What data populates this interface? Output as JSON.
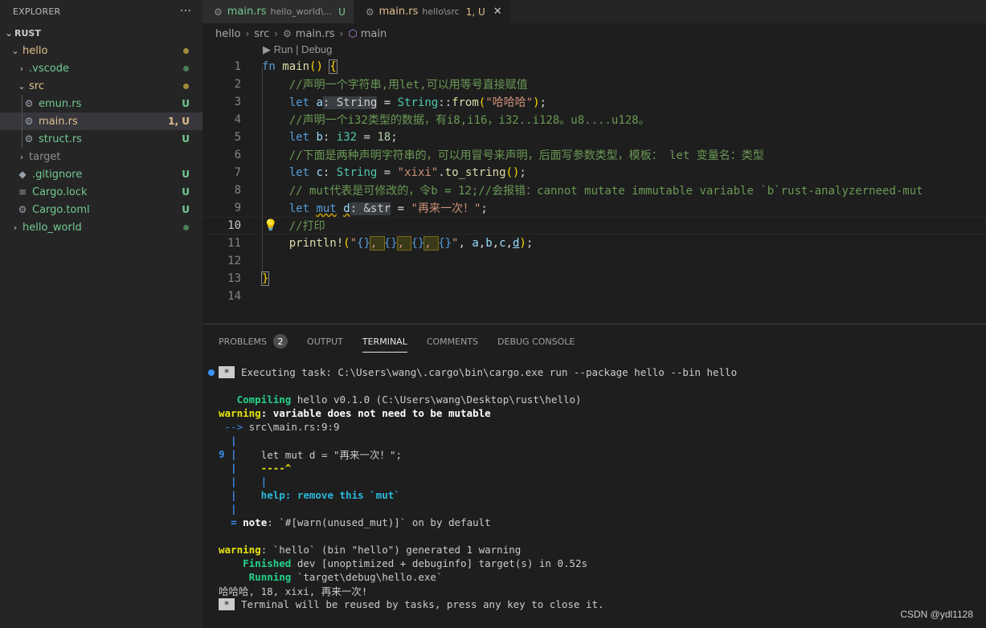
{
  "sidebar": {
    "title": "EXPLORER",
    "more": "···",
    "root": "RUST",
    "items": [
      {
        "label": "hello",
        "status": "",
        "color": "#e2c08d"
      },
      {
        "label": ".vscode",
        "status": "",
        "color": "#73c991"
      },
      {
        "label": "src",
        "status": "",
        "color": "#e2c08d"
      },
      {
        "label": "emun.rs",
        "status": "U",
        "color": "#73c991"
      },
      {
        "label": "main.rs",
        "status": "1, U",
        "color": "#e2c08d"
      },
      {
        "label": "struct.rs",
        "status": "U",
        "color": "#73c991"
      },
      {
        "label": "target",
        "status": "",
        "color": "#8c8c8c"
      },
      {
        "label": ".gitignore",
        "status": "U",
        "color": "#73c991"
      },
      {
        "label": "Cargo.lock",
        "status": "U",
        "color": "#73c991"
      },
      {
        "label": "Cargo.toml",
        "status": "U",
        "color": "#73c991"
      },
      {
        "label": "hello_world",
        "status": "",
        "color": "#73c991"
      }
    ]
  },
  "tabs": [
    {
      "name": "main.rs",
      "desc": "hello_world\\...",
      "status": "U"
    },
    {
      "name": "main.rs",
      "desc": "hello\\src",
      "status": "1, U",
      "close": "✕"
    }
  ],
  "breadcrumb": [
    "hello",
    "src",
    "main.rs",
    "main"
  ],
  "editor": {
    "codelens": "▶ Run | Debug",
    "line_numbers": [
      "1",
      "2",
      "3",
      "4",
      "5",
      "6",
      "7",
      "8",
      "9",
      "10",
      "11",
      "12",
      "13",
      "14"
    ],
    "comments": {
      "l2": "//声明一个字符串,用let,可以用等号直接赋值",
      "l4": "//声明一个i32类型的数据，有i8,i16，i32..i128。u8....u128。",
      "l6": "//下面是两种声明字符串的，可以用冒号来声明，后面写参数类型，模板： let 变量名：类型",
      "l8": "// mut代表是可修改的，令b = 12;//会报错：cannot mutate immutable variable `b`rust-analyzerneed-mut",
      "l10": "//打印"
    },
    "strings": {
      "a": "\"哈哈哈\"",
      "c": "\"xixi\"",
      "d": "\"再来一次！\""
    },
    "numbers": {
      "b": "18"
    }
  },
  "panel": {
    "tabs": [
      "PROBLEMS",
      "OUTPUT",
      "TERMINAL",
      "COMMENTS",
      "DEBUG CONSOLE"
    ],
    "problems_count": "2",
    "active_tab": "TERMINAL"
  },
  "terminal": {
    "task": "Executing task: C:\\Users\\wang\\.cargo\\bin\\cargo.exe run --package hello --bin hello",
    "compiling_kw": "Compiling",
    "compiling_rest": " hello v0.1.0 (C:\\Users\\wang\\Desktop\\rust\\hello)",
    "warning_kw": "warning",
    "warning1_rest": ": variable does not need to be mutable",
    "arrow": "-->",
    "location": " src\\main.rs:9:9",
    "src_line_no": "9",
    "src_line": "    let mut d = \"再来一次！\";",
    "caret": "    ----^",
    "help_pipe": "    |",
    "help": "    help: remove this `mut`",
    "note_eq": "=",
    "note_kw": "note",
    "note_rest": ": `#[warn(unused_mut)]` on by default",
    "warning2_rest": ": `hello` (bin \"hello\") generated 1 warning",
    "finished_kw": "Finished",
    "finished_rest": " dev [unoptimized + debuginfo] target(s) in 0.52s",
    "running_kw": "Running",
    "running_rest": " `target\\debug\\hello.exe`",
    "output": "哈哈哈, 18, xixi, 再来一次!",
    "reuse": "Terminal will be reused by tasks, press any key to close it."
  },
  "watermark": "CSDN @ydl1128"
}
